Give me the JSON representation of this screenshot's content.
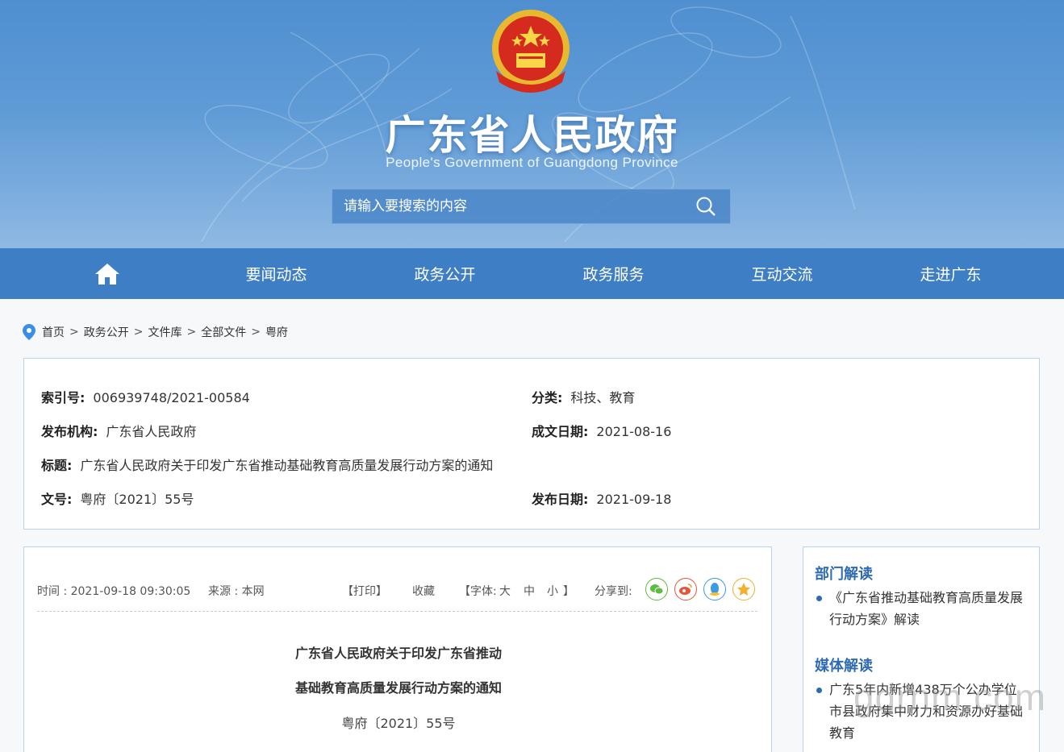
{
  "header": {
    "site_title": "广东省人民政府",
    "site_subtitle": "People's Government of Guangdong Province",
    "emblem": "national-emblem",
    "search": {
      "placeholder": "请输入要搜索的内容",
      "icon": "search-icon"
    }
  },
  "nav": {
    "home_icon": "home-icon",
    "items": [
      "要闻动态",
      "政务公开",
      "政务服务",
      "互动交流",
      "走进广东"
    ]
  },
  "breadcrumb": {
    "icon": "location-pin-icon",
    "items": [
      "首页",
      "政务公开",
      "文件库",
      "全部文件",
      "粤府"
    ],
    "separator": ">"
  },
  "info": {
    "index_label": "索引号:",
    "index_value": "006939748/2021-00584",
    "category_label": "分类:",
    "category_value": "科技、教育",
    "issuer_label": "发布机构:",
    "issuer_value": "广东省人民政府",
    "written_date_label": "成文日期:",
    "written_date_value": "2021-08-16",
    "title_label": "标题:",
    "title_value": "广东省人民政府关于印发广东省推动基础教育高质量发展行动方案的通知",
    "doc_no_label": "文号:",
    "doc_no_value": "粤府〔2021〕55号",
    "publish_date_label": "发布日期:",
    "publish_date_value": "2021-09-18"
  },
  "article": {
    "time": "时间 : 2021-09-18 09:30:05",
    "source": "来源 : 本网",
    "print": "【打印】",
    "favorite": "收藏",
    "font_label": "【字体:",
    "font_large": "大",
    "font_medium": "中",
    "font_small": "小",
    "font_close": "】",
    "share_label": "分享到:",
    "share_icons": [
      "wechat-icon",
      "weibo-icon",
      "qq-icon",
      "qzone-icon"
    ],
    "title_line1": "广东省人民政府关于印发广东省推动",
    "title_line2": "基础教育高质量发展行动方案的通知",
    "doc_number": "粤府〔2021〕55号"
  },
  "sidebar": {
    "dept_heading": "部门解读",
    "dept_items": [
      "《广东省推动基础教育高质量发展行动方案》解读"
    ],
    "media_heading": "媒体解读",
    "media_items": [
      "广东5年内新增438万个公办学位 市县政府集中财力和资源办好基础教育"
    ]
  },
  "watermark": "gdrnm.com",
  "colors": {
    "nav_bg": "#3e7ec4",
    "banner": "#5f9bd6",
    "accent": "#2e6bb3",
    "border": "#b9d3ee"
  }
}
